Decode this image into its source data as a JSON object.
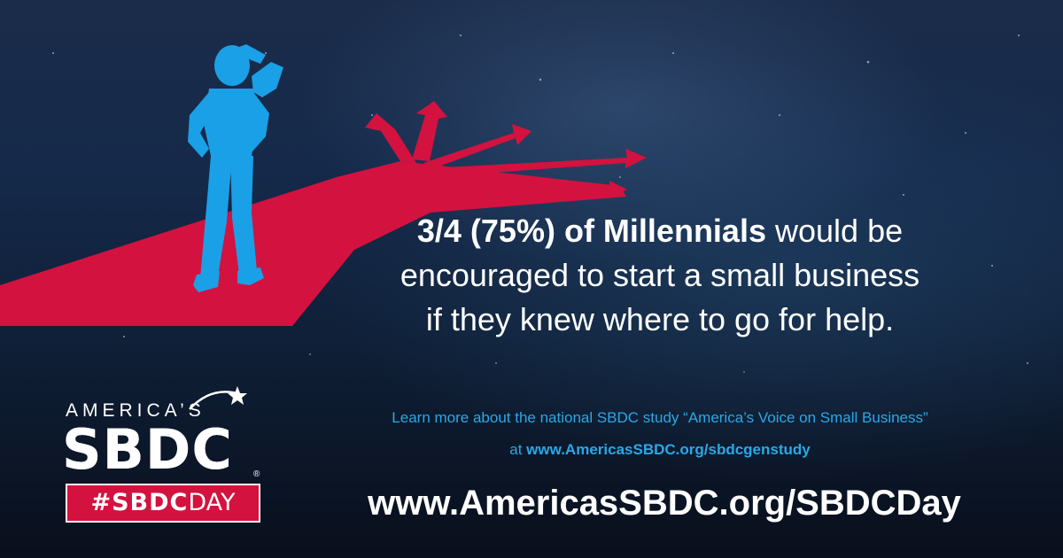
{
  "headline": {
    "line1_bold": "3/4 (75%) of Millennials",
    "line1_rest": "would be",
    "line2": "encouraged to start a small business",
    "line3": "if they knew where to go for help."
  },
  "study": {
    "line1": "Learn more about the national SBDC study “America’s Voice on Small Business”",
    "line2_prefix": "at",
    "line2_url": "www.AmericasSBDC.org/sbdcgenstudy"
  },
  "main_url": "www.AmericasSBDC.org/SBDCDay",
  "logo": {
    "top_text": "AMERICA’S",
    "wordmark": "SBDC",
    "registered": "®",
    "hashtag_bold": "#SBDC",
    "hashtag_light": "DAY"
  },
  "colors": {
    "path_red": "#d3123f",
    "silhouette_blue": "#1aa0e6",
    "link_blue": "#2aa8e6",
    "background_navy": "#0f2038"
  },
  "icons": {
    "figure": "person-silhouette-icon",
    "arrows": "diverging-arrows-icon",
    "star": "star-icon"
  }
}
